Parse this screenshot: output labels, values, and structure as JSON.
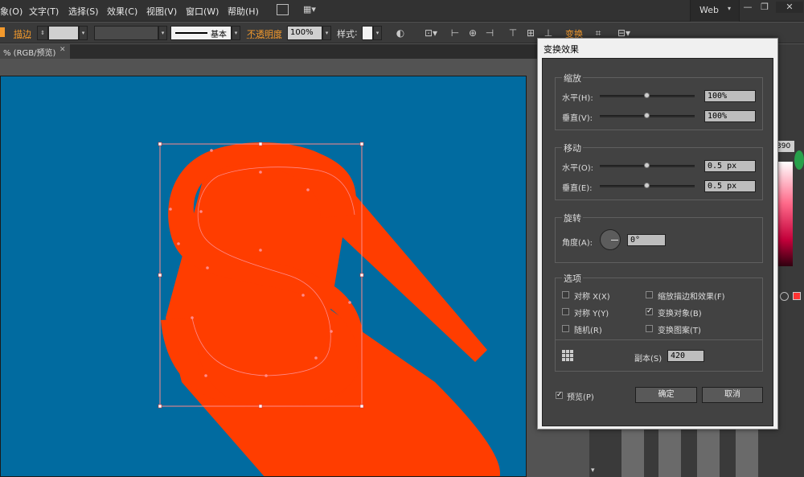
{
  "menubar": {
    "items": [
      "象(O)",
      "文字(T)",
      "选择(S)",
      "效果(C)",
      "视图(V)",
      "窗口(W)",
      "帮助(H)"
    ],
    "workspace": "Web",
    "win_min": "—",
    "win_restore": "❐",
    "win_close": "✕"
  },
  "control_bar": {
    "stroke_label": "描边",
    "stroke_profile": "基本",
    "opacity_label": "不透明度",
    "opacity_value": "100%",
    "style_label": "样式",
    "transform_label": "变换"
  },
  "doc_tab": {
    "title": "% (RGB/预览)",
    "close": "✕"
  },
  "dialog": {
    "title": "变换效果",
    "scale": {
      "title": "缩放",
      "horizontal_label": "水平(H):",
      "horizontal_value": "100%",
      "horizontal_level": 0.5,
      "vertical_label": "垂直(V):",
      "vertical_value": "100%",
      "vertical_level": 0.5
    },
    "move": {
      "title": "移动",
      "horizontal_label": "水平(O):",
      "horizontal_value": "0.5 px",
      "horizontal_level": 0.5,
      "vertical_label": "垂直(E):",
      "vertical_value": "0.5 px",
      "vertical_level": 0.5
    },
    "rotate": {
      "title": "旋转",
      "angle_label": "角度(A):",
      "angle_value": "0°"
    },
    "options": {
      "title": "选项",
      "reflect_x": "对称 X(X)",
      "reflect_x_checked": false,
      "reflect_y": "对称 Y(Y)",
      "reflect_y_checked": false,
      "random": "随机(R)",
      "random_checked": false,
      "scale_strokes": "缩放描边和效果(F)",
      "scale_strokes_checked": false,
      "transform_objects": "变换对象(B)",
      "transform_objects_checked": true,
      "transform_patterns": "变换图案(T)",
      "transform_patterns_checked": false,
      "copies_label": "副本(S)",
      "copies_value": "420"
    },
    "preview_label": "预览(P)",
    "preview_checked": true,
    "ok_label": "确定",
    "cancel_label": "取消"
  },
  "right_panel": {
    "color_value": "390"
  },
  "colors": {
    "artboard": "#016ba0",
    "shape": "#ff3d00",
    "selection": "#ff8a8a"
  }
}
